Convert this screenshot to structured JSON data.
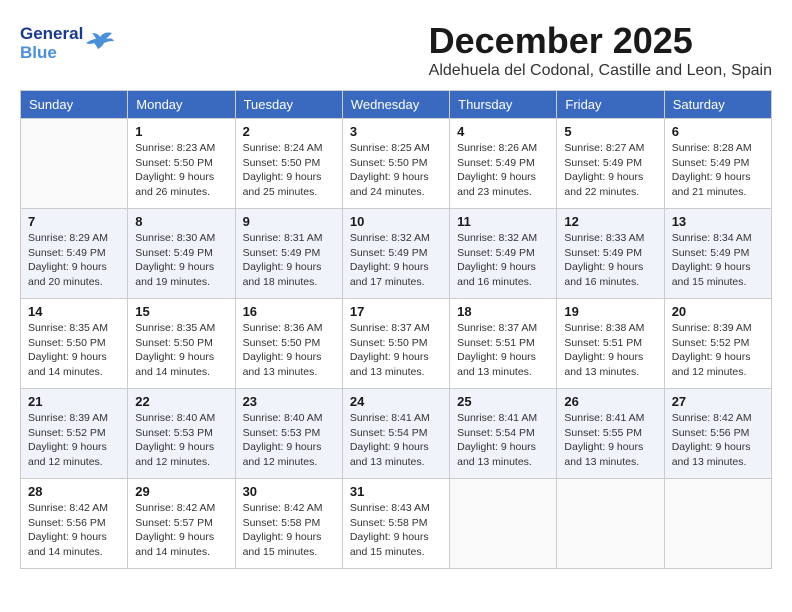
{
  "logo": {
    "line1": "General",
    "line2": "Blue"
  },
  "title": "December 2025",
  "location": "Aldehuela del Codonal, Castille and Leon, Spain",
  "weekdays": [
    "Sunday",
    "Monday",
    "Tuesday",
    "Wednesday",
    "Thursday",
    "Friday",
    "Saturday"
  ],
  "weeks": [
    [
      {
        "day": "",
        "info": ""
      },
      {
        "day": "1",
        "info": "Sunrise: 8:23 AM\nSunset: 5:50 PM\nDaylight: 9 hours\nand 26 minutes."
      },
      {
        "day": "2",
        "info": "Sunrise: 8:24 AM\nSunset: 5:50 PM\nDaylight: 9 hours\nand 25 minutes."
      },
      {
        "day": "3",
        "info": "Sunrise: 8:25 AM\nSunset: 5:50 PM\nDaylight: 9 hours\nand 24 minutes."
      },
      {
        "day": "4",
        "info": "Sunrise: 8:26 AM\nSunset: 5:49 PM\nDaylight: 9 hours\nand 23 minutes."
      },
      {
        "day": "5",
        "info": "Sunrise: 8:27 AM\nSunset: 5:49 PM\nDaylight: 9 hours\nand 22 minutes."
      },
      {
        "day": "6",
        "info": "Sunrise: 8:28 AM\nSunset: 5:49 PM\nDaylight: 9 hours\nand 21 minutes."
      }
    ],
    [
      {
        "day": "7",
        "info": "Sunrise: 8:29 AM\nSunset: 5:49 PM\nDaylight: 9 hours\nand 20 minutes."
      },
      {
        "day": "8",
        "info": "Sunrise: 8:30 AM\nSunset: 5:49 PM\nDaylight: 9 hours\nand 19 minutes."
      },
      {
        "day": "9",
        "info": "Sunrise: 8:31 AM\nSunset: 5:49 PM\nDaylight: 9 hours\nand 18 minutes."
      },
      {
        "day": "10",
        "info": "Sunrise: 8:32 AM\nSunset: 5:49 PM\nDaylight: 9 hours\nand 17 minutes."
      },
      {
        "day": "11",
        "info": "Sunrise: 8:32 AM\nSunset: 5:49 PM\nDaylight: 9 hours\nand 16 minutes."
      },
      {
        "day": "12",
        "info": "Sunrise: 8:33 AM\nSunset: 5:49 PM\nDaylight: 9 hours\nand 16 minutes."
      },
      {
        "day": "13",
        "info": "Sunrise: 8:34 AM\nSunset: 5:49 PM\nDaylight: 9 hours\nand 15 minutes."
      }
    ],
    [
      {
        "day": "14",
        "info": "Sunrise: 8:35 AM\nSunset: 5:50 PM\nDaylight: 9 hours\nand 14 minutes."
      },
      {
        "day": "15",
        "info": "Sunrise: 8:35 AM\nSunset: 5:50 PM\nDaylight: 9 hours\nand 14 minutes."
      },
      {
        "day": "16",
        "info": "Sunrise: 8:36 AM\nSunset: 5:50 PM\nDaylight: 9 hours\nand 13 minutes."
      },
      {
        "day": "17",
        "info": "Sunrise: 8:37 AM\nSunset: 5:50 PM\nDaylight: 9 hours\nand 13 minutes."
      },
      {
        "day": "18",
        "info": "Sunrise: 8:37 AM\nSunset: 5:51 PM\nDaylight: 9 hours\nand 13 minutes."
      },
      {
        "day": "19",
        "info": "Sunrise: 8:38 AM\nSunset: 5:51 PM\nDaylight: 9 hours\nand 13 minutes."
      },
      {
        "day": "20",
        "info": "Sunrise: 8:39 AM\nSunset: 5:52 PM\nDaylight: 9 hours\nand 12 minutes."
      }
    ],
    [
      {
        "day": "21",
        "info": "Sunrise: 8:39 AM\nSunset: 5:52 PM\nDaylight: 9 hours\nand 12 minutes."
      },
      {
        "day": "22",
        "info": "Sunrise: 8:40 AM\nSunset: 5:53 PM\nDaylight: 9 hours\nand 12 minutes."
      },
      {
        "day": "23",
        "info": "Sunrise: 8:40 AM\nSunset: 5:53 PM\nDaylight: 9 hours\nand 12 minutes."
      },
      {
        "day": "24",
        "info": "Sunrise: 8:41 AM\nSunset: 5:54 PM\nDaylight: 9 hours\nand 13 minutes."
      },
      {
        "day": "25",
        "info": "Sunrise: 8:41 AM\nSunset: 5:54 PM\nDaylight: 9 hours\nand 13 minutes."
      },
      {
        "day": "26",
        "info": "Sunrise: 8:41 AM\nSunset: 5:55 PM\nDaylight: 9 hours\nand 13 minutes."
      },
      {
        "day": "27",
        "info": "Sunrise: 8:42 AM\nSunset: 5:56 PM\nDaylight: 9 hours\nand 13 minutes."
      }
    ],
    [
      {
        "day": "28",
        "info": "Sunrise: 8:42 AM\nSunset: 5:56 PM\nDaylight: 9 hours\nand 14 minutes."
      },
      {
        "day": "29",
        "info": "Sunrise: 8:42 AM\nSunset: 5:57 PM\nDaylight: 9 hours\nand 14 minutes."
      },
      {
        "day": "30",
        "info": "Sunrise: 8:42 AM\nSunset: 5:58 PM\nDaylight: 9 hours\nand 15 minutes."
      },
      {
        "day": "31",
        "info": "Sunrise: 8:43 AM\nSunset: 5:58 PM\nDaylight: 9 hours\nand 15 minutes."
      },
      {
        "day": "",
        "info": ""
      },
      {
        "day": "",
        "info": ""
      },
      {
        "day": "",
        "info": ""
      }
    ]
  ]
}
